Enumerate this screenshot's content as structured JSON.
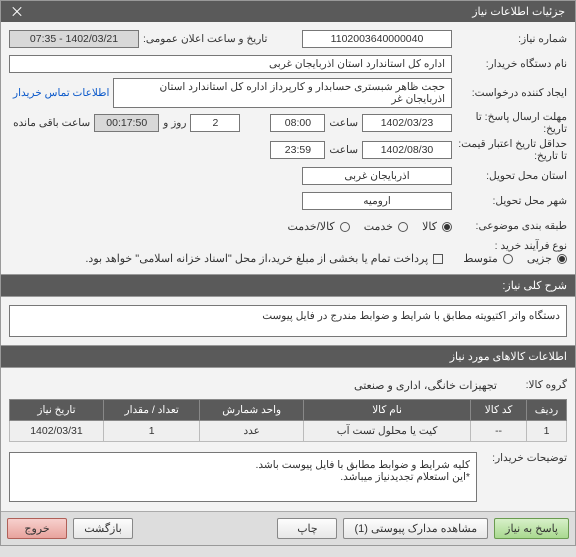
{
  "header": {
    "title": "جزئیات اطلاعات نیاز"
  },
  "labels": {
    "need_no": "شماره نیاز:",
    "buyer": "نام دستگاه خریدار:",
    "requester": "ایجاد کننده درخواست:",
    "deadline": "مهلت ارسال پاسخ: تا تاریخ:",
    "validity": "حداقل تاریخ اعتبار قیمت: تا تاریخ:",
    "province": "استان محل تحویل:",
    "city": "شهر محل تحویل:",
    "category": "طبقه بندی موضوعی:",
    "process": "نوع فرآیند خرید :",
    "announce": "تاریخ و ساعت اعلان عمومی:",
    "contact": "اطلاعات تماس خریدار",
    "time": "ساعت",
    "day_and": "روز و",
    "remaining": "ساعت باقی مانده",
    "cat_goods": "کالا",
    "cat_service": "خدمت",
    "cat_both": "کالا/خدمت",
    "proc_partial": "جزیی",
    "proc_medium": "متوسط",
    "pay_note": "پرداخت تمام یا بخشی از مبلغ خرید،از محل \"اسناد خزانه اسلامی\" خواهد بود.",
    "need_title": "شرح کلی نیاز:",
    "goods_info": "اطلاعات کالاهای مورد نیاز",
    "goods_group": "گروه کالا:",
    "buyer_notes": "توضیحات خریدار:"
  },
  "values": {
    "need_no": "1102003640000040",
    "announce_date": "1402/03/21 - 07:35",
    "buyer": "اداره کل استاندارد استان اذربایجان غربی",
    "requester": "حجت ظاهر شبستری حسابدار و کارپرداز اداره کل استاندارد استان اذربایجان غر",
    "deadline_date": "1402/03/23",
    "deadline_time": "08:00",
    "days_left": "2",
    "time_left": "00:17:50",
    "validity_date": "1402/08/30",
    "validity_time": "23:59",
    "province": "اذربایجان غربی",
    "city": "ارومیه",
    "need_title_text": "دستگاه واتر اکتیویته مطابق با شرایط و ضوابط مندرج در فایل پیوست",
    "goods_group_text": "تجهیزات خانگی، اداری و صنعتی",
    "buyer_notes_text": "کلیه شرایط و ضوابط مطابق با فایل پیوست باشد.\n*این استعلام تجدیدنیاز میباشد."
  },
  "table": {
    "headers": {
      "row": "ردیف",
      "code": "کد کالا",
      "name": "نام کالا",
      "unit": "واحد شمارش",
      "qty": "تعداد / مقدار",
      "date": "تاریخ نیاز"
    },
    "rows": [
      {
        "row": "1",
        "code": "--",
        "name": "کیت یا محلول تست آب",
        "unit": "عدد",
        "qty": "1",
        "date": "1402/03/31"
      }
    ]
  },
  "footer": {
    "respond": "پاسخ به نیاز",
    "attachments": "مشاهده مدارک پیوستی (1)",
    "print": "چاپ",
    "back": "بازگشت",
    "exit": "خروج"
  }
}
